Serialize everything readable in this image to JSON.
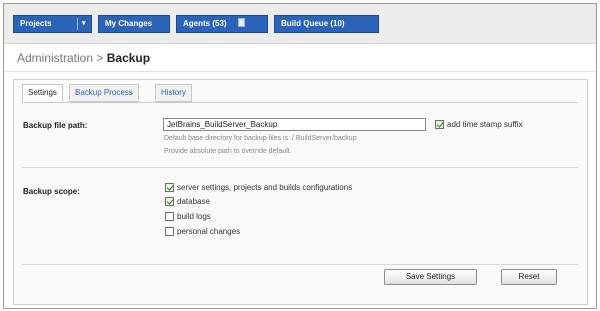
{
  "nav": {
    "projects_label": "Projects",
    "my_changes_label": "My Changes",
    "agents_label": "Agents (53)",
    "build_queue_label": "Build Queue (10)"
  },
  "breadcrumb": {
    "parent": "Administration",
    "separator": ">",
    "current": "Backup"
  },
  "tabs": [
    {
      "label": "Settings",
      "active": true
    },
    {
      "label": "Backup Process",
      "active": false
    },
    {
      "label": "History",
      "active": false
    }
  ],
  "backup_file_path": {
    "label": "Backup file path:",
    "value": "JetBrains_BuildServer_Backup",
    "timestamp_label": "add time stamp suffix",
    "timestamp_checked": true,
    "hint_default": "Default base directory for backup files is ./.BuildServer/backup",
    "hint_absolute": "Provide absolute path to override default."
  },
  "backup_scope": {
    "label": "Backup scope:",
    "options": [
      {
        "label": "server settings, projects and builds configurations",
        "checked": true
      },
      {
        "label": "database",
        "checked": true
      },
      {
        "label": "build logs",
        "checked": false
      },
      {
        "label": "personal changes",
        "checked": false
      }
    ]
  },
  "buttons": {
    "save_label": "Save Settings",
    "reset_label": "Reset"
  },
  "colors": {
    "nav_button": "#2a63b8",
    "link": "#2a63b8",
    "check": "#2e7d1f"
  }
}
